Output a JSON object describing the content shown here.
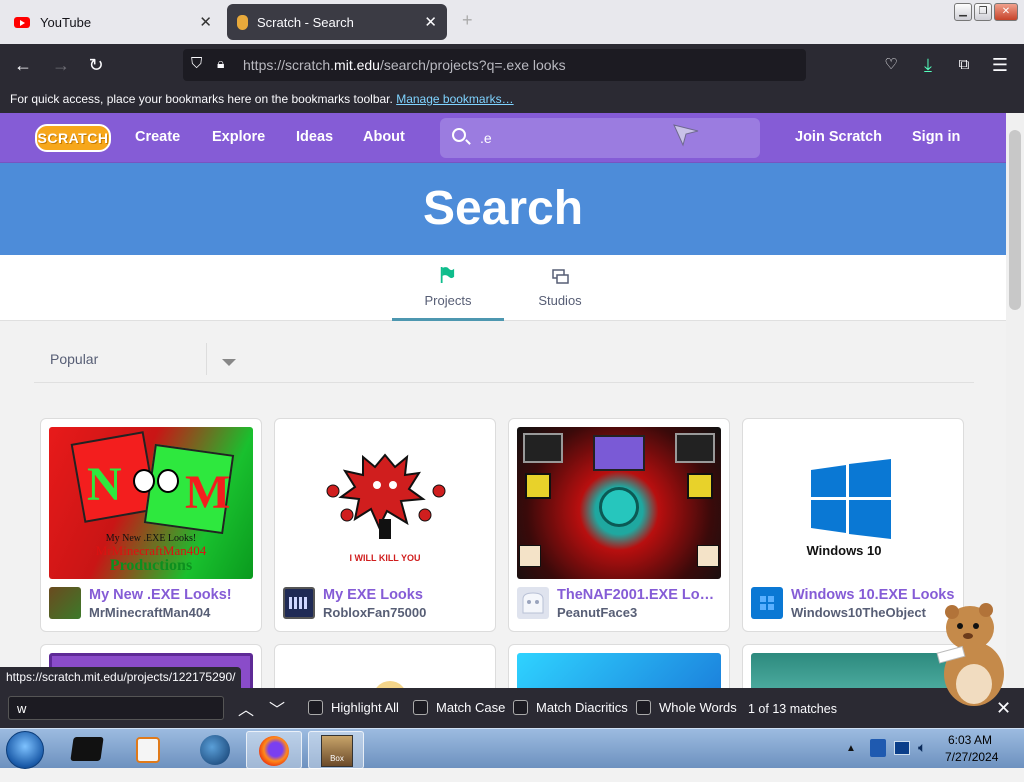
{
  "browser": {
    "tabs": [
      {
        "label": "YouTube"
      },
      {
        "label": "Scratch - Search"
      }
    ],
    "address": {
      "prefix": "https://scratch.",
      "domain": "mit.edu",
      "suffix": "/search/projects?q=.exe looks"
    },
    "bookmarks_text": "For quick access, place your bookmarks here on the bookmarks toolbar.",
    "bookmarks_link": "Manage bookmarks…"
  },
  "scratch": {
    "logo": "SCRATCH",
    "nav": [
      "Create",
      "Explore",
      "Ideas",
      "About"
    ],
    "search_value": ".e",
    "join": "Join Scratch",
    "signin": "Sign in",
    "banner_title": "Search",
    "tabs": [
      "Projects",
      "Studios"
    ],
    "sort": "Popular",
    "projects": [
      {
        "title": "My New .EXE Looks!",
        "author": "MrMinecraftMan404",
        "thumb_text1": "My New .EXE Looks!",
        "thumb_text2": "MrMinecraftMan404",
        "thumb_text3": "Productions"
      },
      {
        "title": "My EXE Looks",
        "author": "RobloxFan75000",
        "thumb_text1": "I WILL KILL YOU"
      },
      {
        "title": "TheNAF2001.EXE Lo…",
        "author": "PeanutFace3"
      },
      {
        "title": "Windows 10.EXE Looks",
        "author": "Windows10TheObject",
        "thumb_text1": "Windows 10"
      }
    ]
  },
  "status_url": "https://scratch.mit.edu/projects/122175290/",
  "findbar": {
    "value": "w",
    "options": [
      "Highlight All",
      "Match Case",
      "Match Diacritics",
      "Whole Words"
    ],
    "count": "1 of 13 matches"
  },
  "taskbar": {
    "time": "6:03 AM",
    "date": "7/27/2024"
  }
}
